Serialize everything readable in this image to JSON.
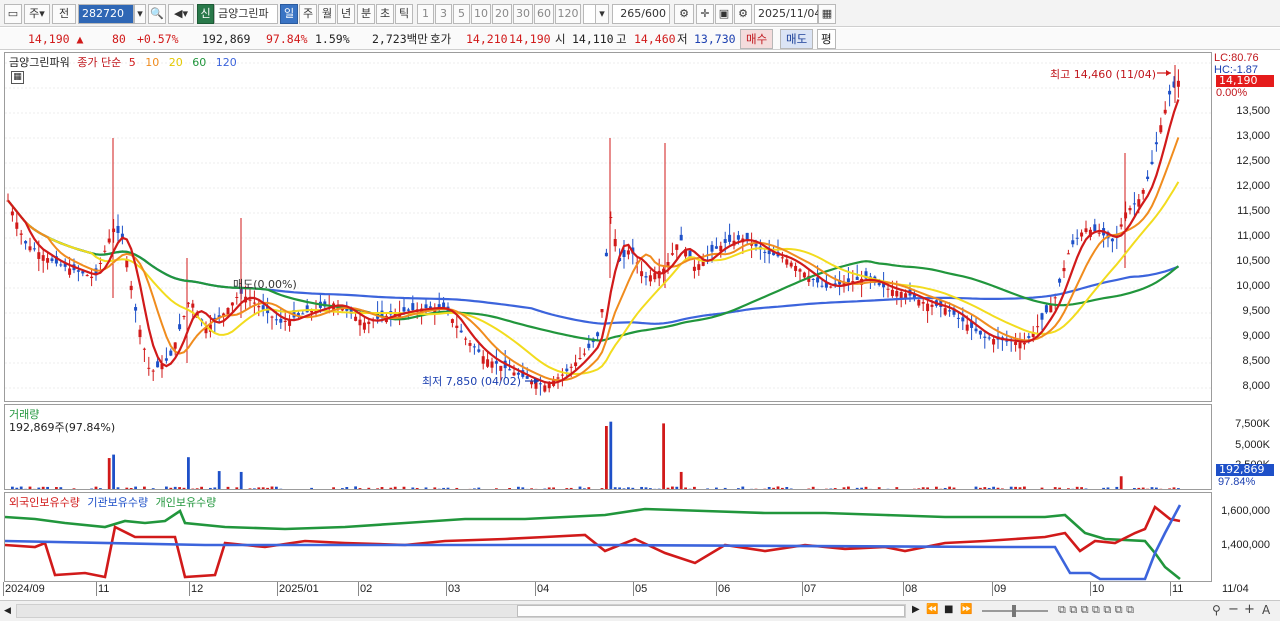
{
  "toolbar": {
    "period_main": "주",
    "period_prev": "전",
    "stock_code": "282720",
    "badge_new": "신",
    "stock_name": "금양그린파",
    "periods": [
      "일",
      "주",
      "월",
      "년",
      "분",
      "초",
      "틱"
    ],
    "minute_options": [
      "1",
      "3",
      "5",
      "10",
      "20",
      "30",
      "60",
      "120"
    ],
    "count_value": "265",
    "count_total": "/600",
    "date_value": "2025/11/04"
  },
  "quote": {
    "price": "14,190",
    "change": "80",
    "change_pct": "+0.57%",
    "volume": "192,869",
    "ratio": "97.84%",
    "turnover": "1.59%",
    "amount": "2,723백만",
    "ask_label": "호가",
    "ask": "14,210",
    "bid": "14,190",
    "open_label": "시",
    "open": "14,110",
    "high_label": "고",
    "high": "14,460",
    "low_label": "저",
    "low": "13,730",
    "buy_label": "매수",
    "sell_label": "매도",
    "avg_label": "평"
  },
  "price_pane": {
    "stock_label": "금양그린파워",
    "ma_prefix": "종가 단순",
    "ma_periods": [
      "5",
      "10",
      "20",
      "60",
      "120"
    ],
    "high_annotation": "최고 14,460 (11/04)",
    "low_annotation": "최저 7,850 (04/02)",
    "mid_annotation": "매도(0.00%)",
    "lc_label": "LC:80.76",
    "hc_label": "HC:-1.87",
    "current_price_tag": "14,190",
    "pct_label": "0.00%",
    "y_ticks": [
      "13,500",
      "13,000",
      "12,500",
      "12,000",
      "11,500",
      "11,000",
      "10,500",
      "10,000",
      "9,500",
      "9,000",
      "8,500",
      "8,000"
    ]
  },
  "volume_pane": {
    "title": "거래량",
    "value_line": "192,869주(97.84%)",
    "y_ticks": [
      "7,500K",
      "5,000K",
      "2,500K"
    ],
    "current_tag": "192,869",
    "pct_tag": "97.84%"
  },
  "holding_pane": {
    "legend": [
      "외국인보유수량",
      "기관보유수량",
      "개인보유수량"
    ],
    "y_ticks": [
      "1,600,000",
      "1,400,000"
    ]
  },
  "x_labels": [
    "2024/09",
    "11",
    "12",
    "2025/01",
    "02",
    "03",
    "04",
    "05",
    "06",
    "07",
    "08",
    "09",
    "10",
    "11",
    "11/04"
  ],
  "colors": {
    "up": "#d11a1a",
    "down": "#1e50c8",
    "ma5": "#d11a1a",
    "ma10": "#f08c1e",
    "ma20": "#f2dc1e",
    "ma60": "#21963c",
    "ma120": "#3c64dc"
  },
  "chart_data": {
    "type": "candlestick",
    "price_axis": {
      "min": 7700,
      "max": 14700
    },
    "x_start": 1,
    "x_end": 265,
    "high": {
      "value": 14460,
      "date": "11/04"
    },
    "low": {
      "value": 7850,
      "date": "04/02"
    }
  }
}
